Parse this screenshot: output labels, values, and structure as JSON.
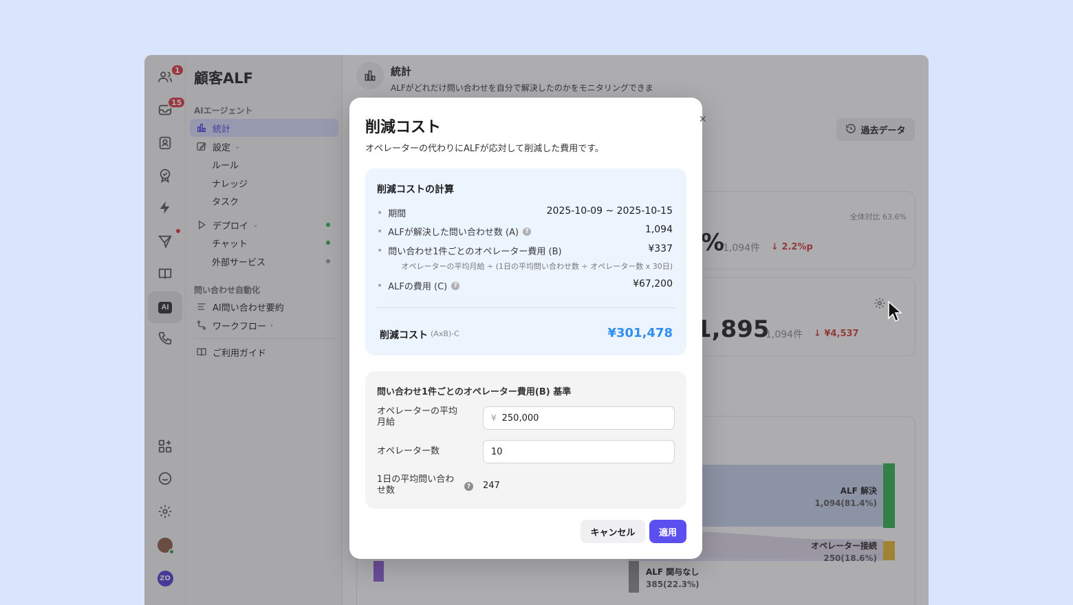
{
  "rail": {
    "people_badge": "1",
    "inbox_badge": "15",
    "ai_label": "AI",
    "zo_label": "ZO"
  },
  "nav": {
    "brand": "顧客ALF",
    "section_ai": "AIエージェント",
    "item_stats": "統計",
    "item_settings": "設定",
    "item_rules": "ルール",
    "item_knowledge": "ナレッジ",
    "item_tasks": "タスク",
    "item_deploy": "デプロイ",
    "item_chat": "チャット",
    "item_external": "外部サービス",
    "section_auto": "問い合わせ自動化",
    "item_summary": "AI問い合わせ要約",
    "item_workflow": "ワークフロー",
    "item_guide": "ご利用ガイド"
  },
  "page": {
    "title": "統計",
    "description": "ALFがどれだけ問い合わせを自分で解決したのかをモニタリングできま",
    "history_button": "過去データ"
  },
  "background_cards": {
    "card1_ratio": "全体対比 63.6%",
    "card1_pct": "%",
    "card1_count": "1,094件",
    "card1_delta": "2.2%p",
    "card2_value": "1,895",
    "card2_count": "1,094件",
    "card2_delta": "¥4,537",
    "sankey_resolved_label": "ALF 解決",
    "sankey_resolved_value": "1,094(81.4%)",
    "sankey_operator_label": "オペレーター接続",
    "sankey_operator_value": "250(18.6%)",
    "sankey_none_label": "ALF 関与なし",
    "sankey_none_value": "385(22.3%)"
  },
  "modal": {
    "title": "削減コスト",
    "subtitle": "オペレーターの代わりにALFが応対して削減した費用です。",
    "calc": {
      "heading": "削減コストの計算",
      "period_label": "期間",
      "period_value": "2025-10-09 ~ 2025-10-15",
      "resolved_label": "ALFが解決した問い合わせ数 (A)",
      "resolved_value": "1,094",
      "cost_per_label": "問い合わせ1件ごとのオペレーター費用 (B)",
      "cost_per_value": "¥337",
      "formula": "オペレーターの平均月給 ÷ (1日の平均問い合わせ数 ÷ オペレーター数 x 30日)",
      "alf_cost_label": "ALFの費用 (C)",
      "alf_cost_value": "¥67,200",
      "saved_label": "削減コスト",
      "saved_formula": "(AxB)-C",
      "saved_value": "¥301,478"
    },
    "basis": {
      "heading": "問い合わせ1件ごとのオペレーター費用(B) 基準",
      "salary_label_1": "オペレーターの平均",
      "salary_label_2": "月給",
      "salary_prefix": "¥",
      "salary_value": "250,000",
      "operators_label": "オペレーター数",
      "operators_value": "10",
      "daily_label_1": "1日の平均問い合わ",
      "daily_label_2": "せ数",
      "daily_value": "247"
    },
    "cancel": "キャンセル",
    "apply": "適用"
  }
}
